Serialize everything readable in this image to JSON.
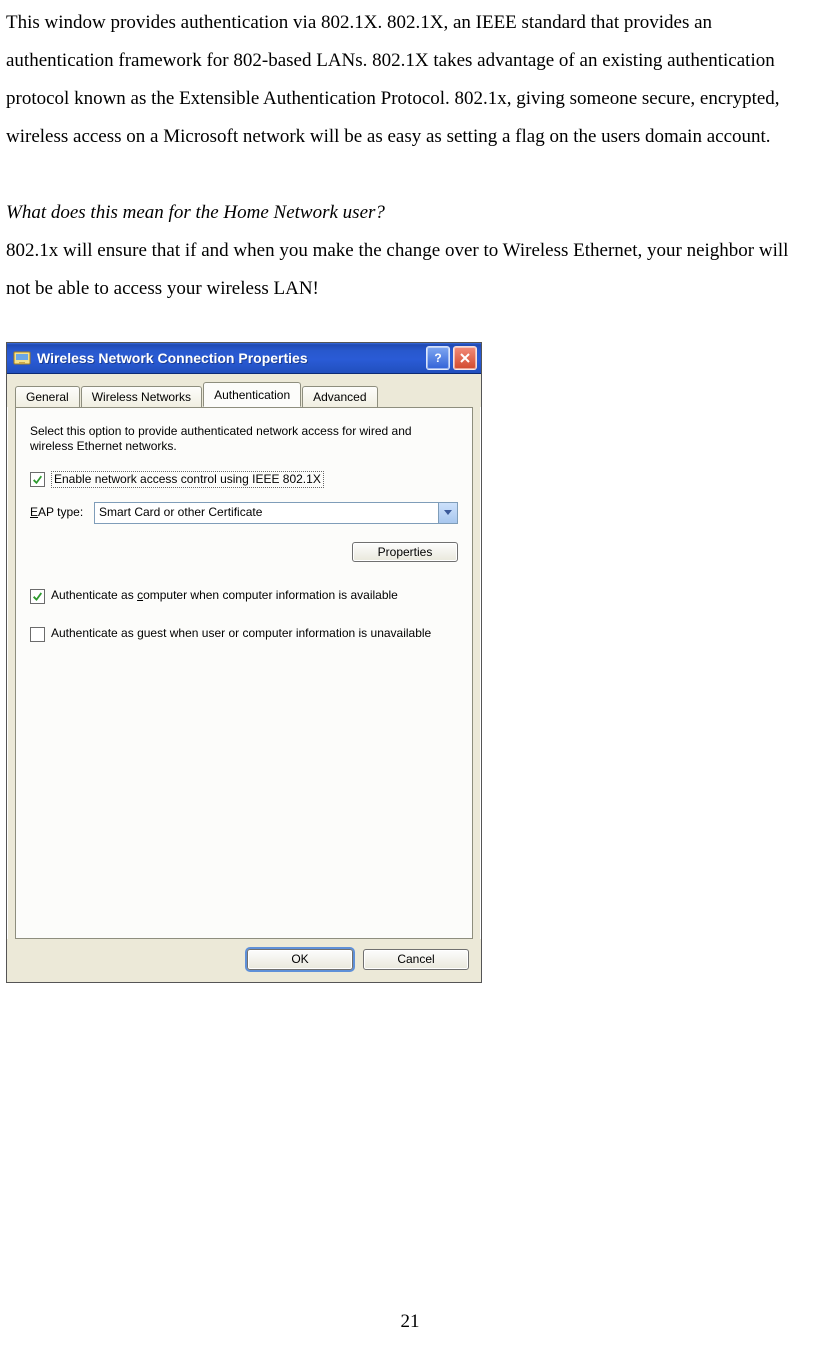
{
  "page_number": "21",
  "text": {
    "p1": "This window provides authentication via 802.1X. 802.1X, an IEEE standard that provides an authentication framework for 802-based LANs. 802.1X takes advantage of an existing authentication protocol known as the Extensible Authentication Protocol. 802.1x, giving someone secure, encrypted, wireless access on a Microsoft network will be as easy as setting a flag on the users domain account.",
    "q": "What does this mean for the Home Network user?",
    "p2": "802.1x will ensure that if and when you make the change over to Wireless Ethernet, your neighbor will not be able to access your wireless LAN!"
  },
  "dialog": {
    "title": "Wireless Network Connection Properties",
    "tabs": [
      "General",
      "Wireless Networks",
      "Authentication",
      "Advanced"
    ],
    "active_tab_index": 2,
    "description": "Select this option to provide authenticated network access for wired and wireless Ethernet networks.",
    "chk_enable": {
      "label": "Enable network access control using IEEE 802.1X",
      "checked": true
    },
    "eap": {
      "label": "EAP type:",
      "value": "Smart Card or other Certificate"
    },
    "btn_properties": "Properties",
    "chk_auth_computer": {
      "label": "Authenticate as computer when computer information is available",
      "checked": true
    },
    "chk_auth_guest": {
      "label": "Authenticate as guest when user or computer information is unavailable",
      "checked": false
    },
    "btn_ok": "OK",
    "btn_cancel": "Cancel"
  }
}
